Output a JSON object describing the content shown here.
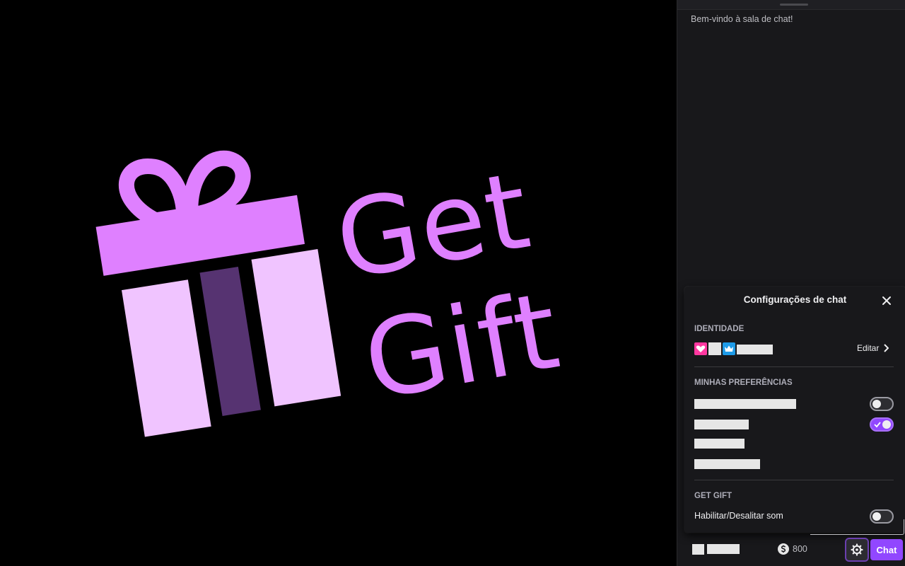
{
  "overlay": {
    "logo_line1": "Get",
    "logo_line2": "Gift",
    "logo_color": "#df80ff",
    "ribbon_color": "#563371",
    "box_light_color": "#f0c4ff"
  },
  "chat": {
    "welcome_message": "Bem-vindo à sala de chat!",
    "settings": {
      "title": "Configurações de chat",
      "close_icon": "close-icon",
      "identity": {
        "section_title": "IDENTIDADE",
        "badges": [
          "heart-badge",
          "crown-badge"
        ],
        "edit_label": "Editar"
      },
      "preferences": {
        "section_title": "MINHAS PREFERÊNCIAS",
        "items": [
          {
            "toggle": "off"
          },
          {
            "toggle": "on"
          },
          {},
          {}
        ]
      },
      "get_gift": {
        "section_title": "GET GIFT",
        "sound_label": "Habilitar/Desalitar som",
        "sound_toggle": "off"
      }
    },
    "bottom_bar": {
      "points": "800",
      "points_icon": "dollar-circle-icon",
      "settings_icon": "gear-icon",
      "chat_button_label": "Chat"
    },
    "accent_color": "#9147ff"
  }
}
